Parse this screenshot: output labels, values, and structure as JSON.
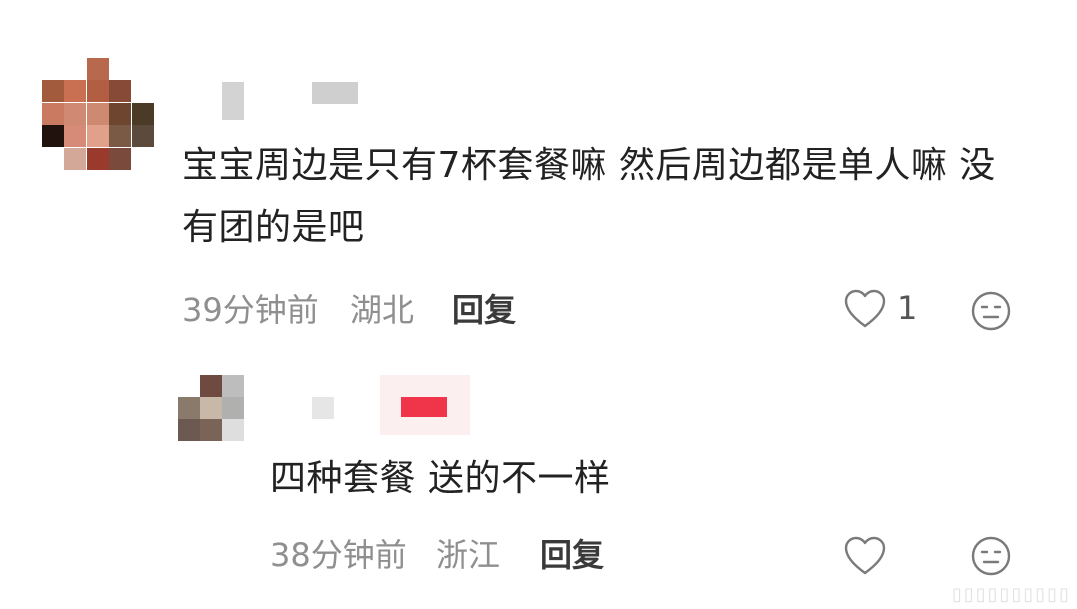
{
  "comment": {
    "text": "宝宝周边是只有7杯套餐嘛 然后周边都是单人嘛 没有团的是吧",
    "time": "39分钟前",
    "location": "湖北",
    "reply_label": "回复",
    "like_count": "1"
  },
  "reply": {
    "text": "四种套餐 送的不一样",
    "time": "38分钟前",
    "location": "浙江",
    "reply_label": "回复"
  },
  "colors": {
    "badge": "#f0344a",
    "meta": "#8f8f8f"
  }
}
